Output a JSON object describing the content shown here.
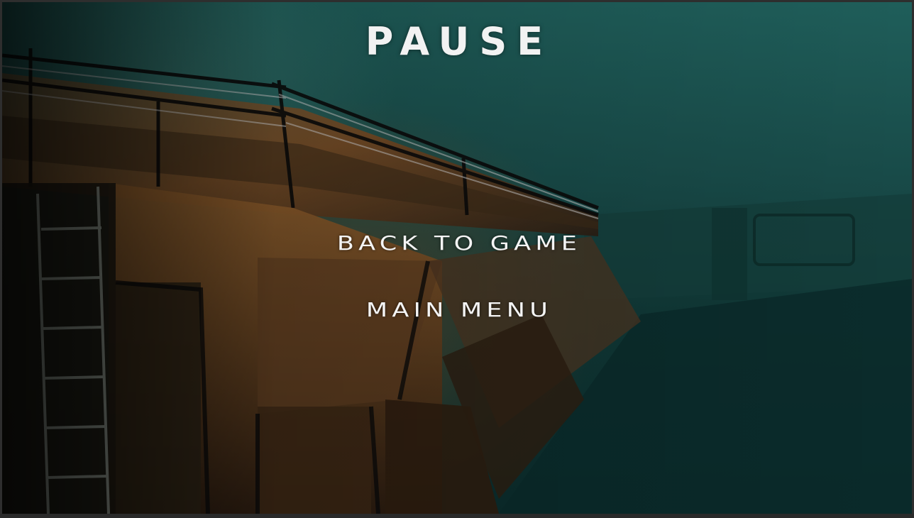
{
  "pause_menu": {
    "title": "PAUSE",
    "buttons": [
      {
        "label": "BACK TO GAME"
      },
      {
        "label": "MAIN MENU"
      }
    ]
  },
  "colors": {
    "text": "#f2f2f2",
    "background_teal": "#184a48",
    "rust": "#7a4a22"
  }
}
